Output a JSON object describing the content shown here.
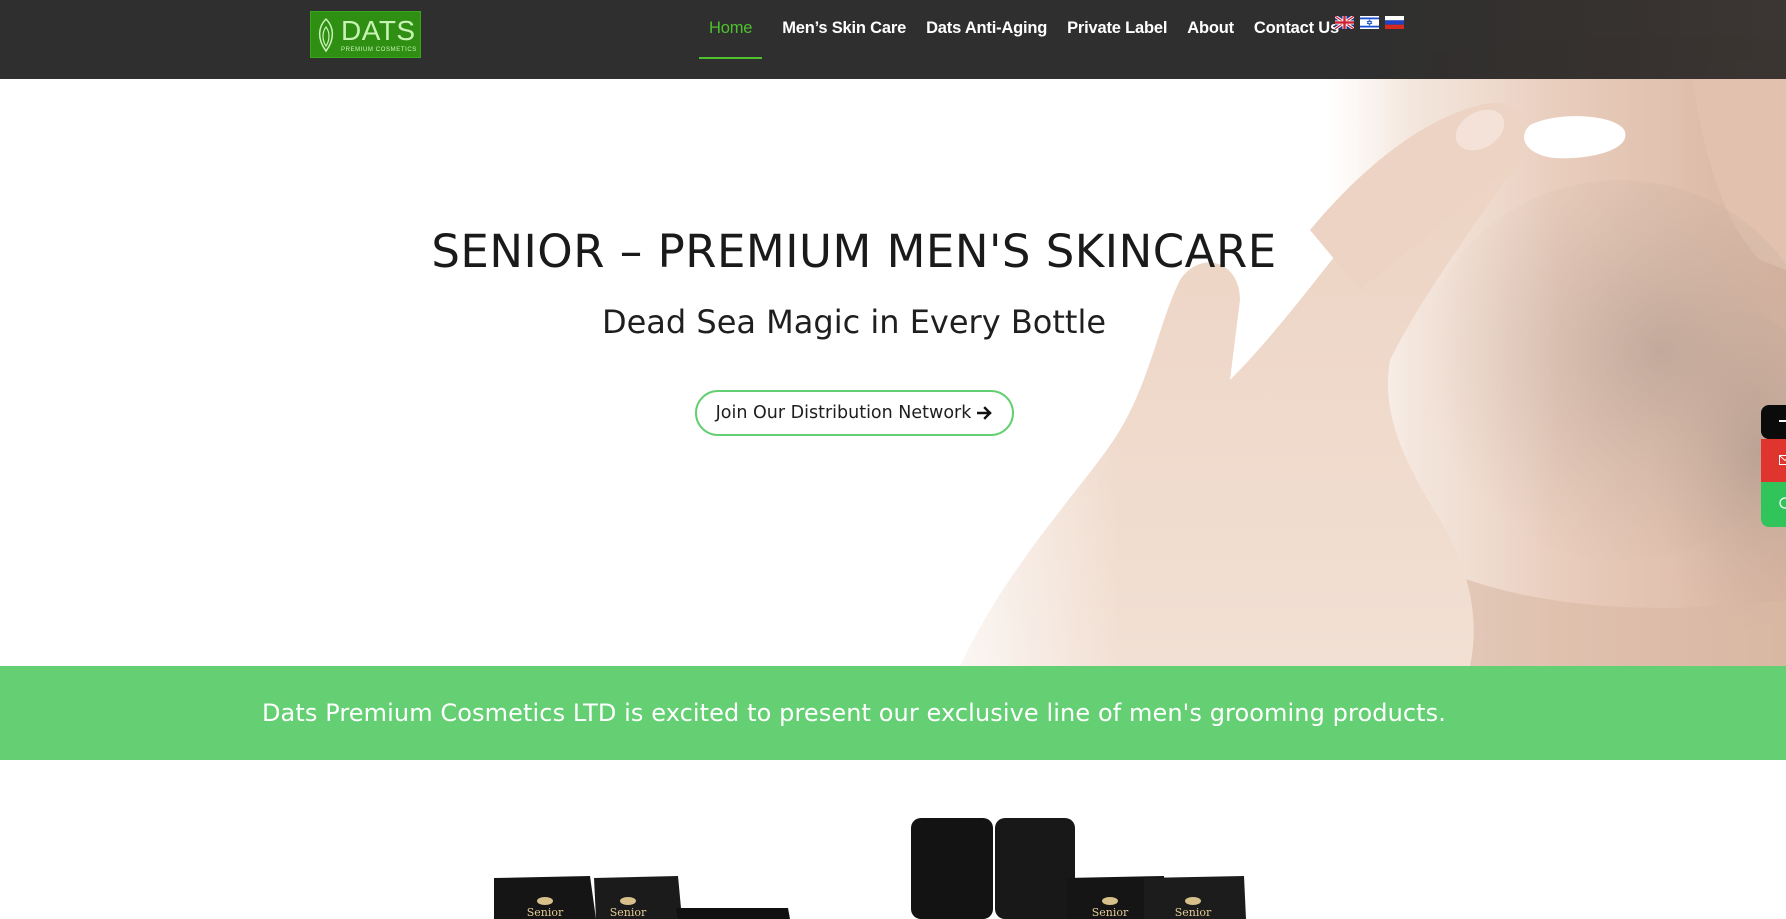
{
  "logo": {
    "word": "DATS",
    "subtitle": "PREMIUM COSMETICS"
  },
  "nav": {
    "items": [
      {
        "label": "Home",
        "active": true
      },
      {
        "label": "Men’s Skin Care",
        "active": false
      },
      {
        "label": "Dats Anti-Aging",
        "active": false
      },
      {
        "label": "Private Label",
        "active": false
      },
      {
        "label": "About",
        "active": false
      },
      {
        "label": "Contact Us",
        "active": false
      }
    ],
    "flags": [
      "english-flag-icon",
      "israel-flag-icon",
      "russia-flag-icon"
    ]
  },
  "hero": {
    "title": "SENIOR – PREMIUM MEN'S SKINCARE",
    "subtitle": "Dead Sea Magic in Every Bottle",
    "cta_label": "Join Our Distribution Network"
  },
  "side_tabs": [
    {
      "icon": "phone-icon",
      "color": "#0b0b0b"
    },
    {
      "icon": "mail-icon",
      "color": "#e0342f"
    },
    {
      "icon": "whatsapp-icon",
      "color": "#31c45a"
    }
  ],
  "banner": {
    "text": "Dats Premium Cosmetics LTD is excited to present our exclusive line of men's grooming products."
  },
  "products": {
    "brand_on_tubes": "Senior"
  },
  "colors": {
    "header_bg": "#282828",
    "accent_green": "#4dc22d",
    "banner_green": "#64cf73",
    "cta_border": "#63cf71"
  }
}
